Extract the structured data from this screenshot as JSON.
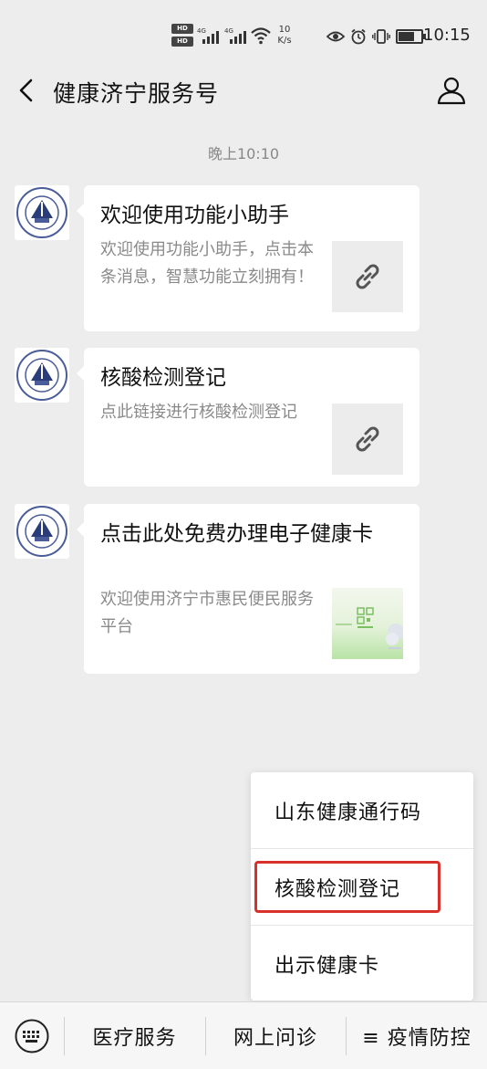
{
  "status_bar": {
    "hd1": "HD",
    "hd2": "HD",
    "net1": "4G",
    "net2": "4G",
    "speed_value": "10",
    "speed_unit": "K/s",
    "time": "10:15",
    "battery_level": 0.75,
    "icons": [
      "eye-icon",
      "alarm-icon",
      "vibrate-icon",
      "battery-icon"
    ]
  },
  "header": {
    "title": "健康济宁服务号",
    "back_icon": "chevron-left",
    "profile_icon": "person-outline"
  },
  "chat": {
    "timestamp": "晚上10:10",
    "messages": [
      {
        "title": "欢迎使用功能小助手",
        "description": "欢迎使用功能小助手，点击本条消息，智慧功能立刻拥有！",
        "thumbnail": "link-icon"
      },
      {
        "title": "核酸检测登记",
        "description": "点此链接进行核酸检测登记",
        "thumbnail": "link-icon"
      },
      {
        "title": "点击此处免费办理电子健康卡",
        "description": "欢迎使用济宁市惠民便民服务平台",
        "thumbnail": "qr-card-image"
      }
    ]
  },
  "popup_menu": {
    "items": [
      "山东健康通行码",
      "核酸检测登记",
      "出示健康卡"
    ],
    "highlighted_index": 1,
    "highlight_color": "#d9302b"
  },
  "bottom_menu": {
    "keyboard_icon": "keyboard-icon",
    "tabs": [
      "医疗服务",
      "网上问诊",
      "≡ 疫情防控"
    ]
  },
  "colors": {
    "background": "#ededed",
    "card": "#ffffff",
    "secondary_text": "#8a8a8a"
  }
}
